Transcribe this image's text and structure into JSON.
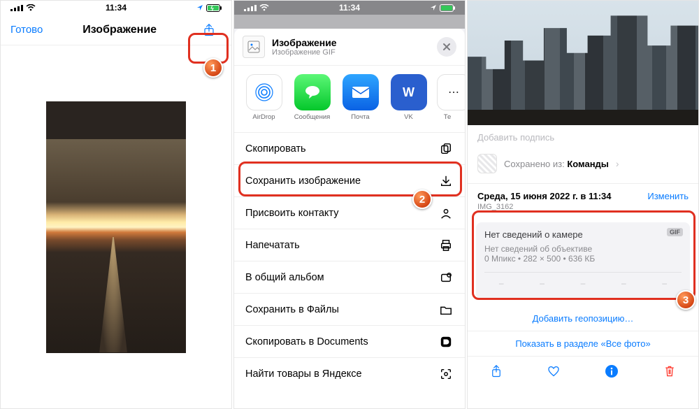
{
  "status": {
    "time": "11:34"
  },
  "s1": {
    "done": "Готово",
    "title": "Изображение"
  },
  "s2": {
    "head_title": "Изображение",
    "head_sub": "Изображение GIF",
    "apps": {
      "airdrop": "AirDrop",
      "messages": "Сообщения",
      "mail": "Почта",
      "vk": "VK",
      "te": "Те"
    },
    "rows": {
      "copy": "Скопировать",
      "save_image": "Сохранить изображение",
      "assign_contact": "Присвоить контакту",
      "print": "Напечатать",
      "shared_album": "В общий альбом",
      "save_files": "Сохранить в Файлы",
      "copy_docs": "Скопировать в Documents",
      "yandex": "Найти товары в Яндексе"
    }
  },
  "s3": {
    "caption_ph": "Добавить подпись",
    "saved_prefix": "Сохранено из: ",
    "saved_app": "Команды",
    "date": "Среда, 15 июня 2022 г. в 11:34",
    "edit": "Изменить",
    "filename": "IMG_3162",
    "cam_h": "Нет сведений о камере",
    "gif": "GIF",
    "lens": "Нет сведений об объективе",
    "dims": "0 Мпикс  •  282 × 500  •  636 КБ",
    "geo": "Добавить геопозицию…",
    "show_all": "Показать в разделе «Все фото»"
  },
  "bubbles": {
    "n1": "1",
    "n2": "2",
    "n3": "3"
  }
}
